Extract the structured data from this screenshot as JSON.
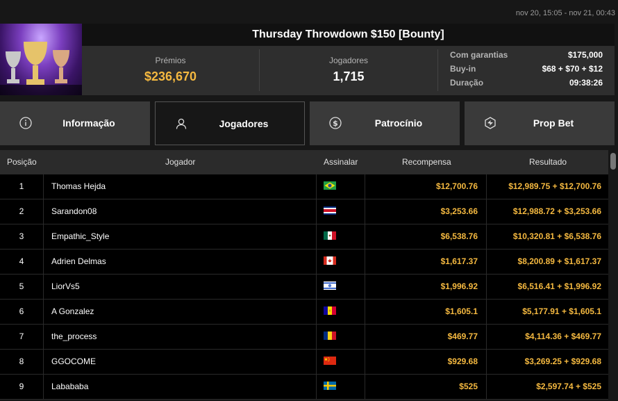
{
  "header": {
    "dates": "nov 20, 15:05 - nov 21, 00:43",
    "title": "Thursday Throwdown $150 [Bounty]"
  },
  "stats": {
    "prize_label": "Prémios",
    "prize_value": "$236,670",
    "players_label": "Jogadores",
    "players_value": "1,715",
    "details": [
      {
        "key": "Com garantias",
        "value": "$175,000"
      },
      {
        "key": "Buy-in",
        "value": "$68 + $70 + $12"
      },
      {
        "key": "Duração",
        "value": "09:38:26"
      }
    ]
  },
  "tabs": [
    {
      "label": "Informação",
      "icon": "info-icon"
    },
    {
      "label": "Jogadores",
      "icon": "user-icon",
      "active": true
    },
    {
      "label": "Patrocínio",
      "icon": "dollar-coin-icon"
    },
    {
      "label": "Prop Bet",
      "icon": "prop-bet-icon"
    }
  ],
  "table": {
    "headers": {
      "position": "Posição",
      "player": "Jogador",
      "flag": "Assinalar",
      "reward": "Recompensa",
      "result": "Resultado"
    },
    "rows": [
      {
        "pos": "1",
        "name": "Thomas Hejda",
        "flag": "brazil-flag",
        "reward": "$12,700.76",
        "result": "$12,989.75 + $12,700.76"
      },
      {
        "pos": "2",
        "name": "Sarandon08",
        "flag": "costa-rica-flag",
        "reward": "$3,253.66",
        "result": "$12,988.72 + $3,253.66"
      },
      {
        "pos": "3",
        "name": "Empathic_Style",
        "flag": "mexico-flag",
        "reward": "$6,538.76",
        "result": "$10,320.81 + $6,538.76"
      },
      {
        "pos": "4",
        "name": "Adrien Delmas",
        "flag": "canada-flag",
        "reward": "$1,617.37",
        "result": "$8,200.89 + $1,617.37"
      },
      {
        "pos": "5",
        "name": "LiorVs5",
        "flag": "israel-flag",
        "reward": "$1,996.92",
        "result": "$6,516.41 + $1,996.92"
      },
      {
        "pos": "6",
        "name": "A Gonzalez",
        "flag": "andorra-flag",
        "reward": "$1,605.1",
        "result": "$5,177.91 + $1,605.1"
      },
      {
        "pos": "7",
        "name": "the_process",
        "flag": "romania-flag",
        "reward": "$469.77",
        "result": "$4,114.36 + $469.77"
      },
      {
        "pos": "8",
        "name": "GGOCOME",
        "flag": "china-flag",
        "reward": "$929.68",
        "result": "$3,269.25 + $929.68"
      },
      {
        "pos": "9",
        "name": "Labababa",
        "flag": "sweden-flag",
        "reward": "$525",
        "result": "$2,597.74 + $525"
      }
    ]
  }
}
